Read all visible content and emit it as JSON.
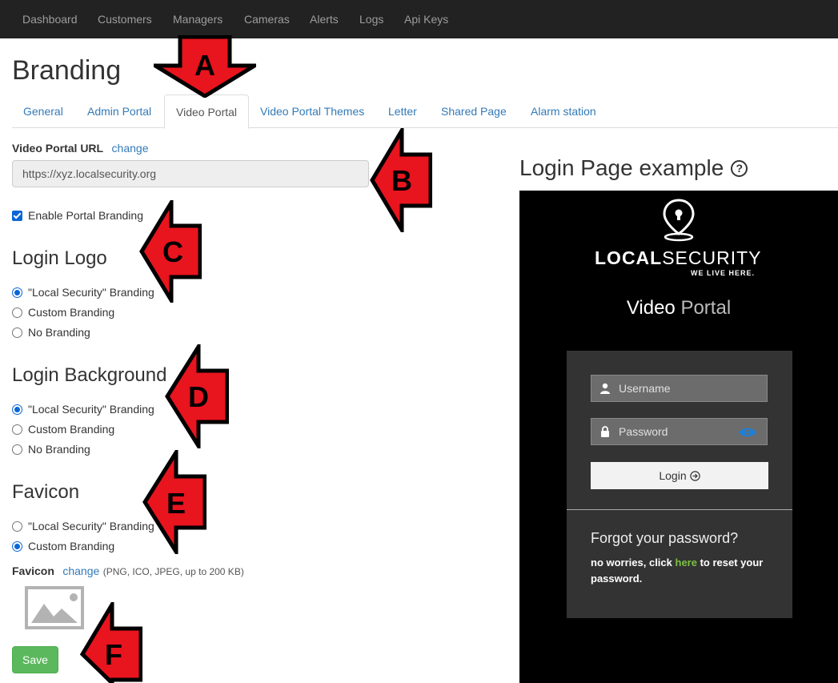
{
  "nav": {
    "items": [
      "Dashboard",
      "Customers",
      "Managers",
      "Cameras",
      "Alerts",
      "Logs",
      "Api Keys"
    ]
  },
  "page": {
    "title": "Branding"
  },
  "tabs": [
    "General",
    "Admin Portal",
    "Video Portal",
    "Video Portal Themes",
    "Letter",
    "Shared Page",
    "Alarm station"
  ],
  "active_tab": "Video Portal",
  "form": {
    "url_label": "Video Portal URL",
    "url_change": "change",
    "url_value": "https://xyz.localsecurity.org",
    "enable_label": "Enable Portal Branding",
    "enable_checked": true,
    "login_logo": {
      "title": "Login Logo",
      "options": [
        "\"Local Security\" Branding",
        "Custom Branding",
        "No Branding"
      ],
      "selected": 0
    },
    "login_background": {
      "title": "Login Background",
      "options": [
        "\"Local Security\" Branding",
        "Custom Branding",
        "No Branding"
      ],
      "selected": 0
    },
    "favicon": {
      "title": "Favicon",
      "options": [
        "\"Local Security\" Branding",
        "Custom Branding"
      ],
      "selected": 1,
      "label": "Favicon",
      "change": "change",
      "hint": "(PNG, ICO, JPEG, up to 200 KB)"
    },
    "save_label": "Save"
  },
  "preview": {
    "title": "Login Page example",
    "help_icon": "question-circle-icon",
    "brand_bold": "LOCAL",
    "brand_light": "SECURITY",
    "brand_tagline": "WE LIVE HERE.",
    "portal_title_a": "Video",
    "portal_title_b": "Portal",
    "username_placeholder": "Username",
    "password_placeholder": "Password",
    "login_label": "Login",
    "forgot_title": "Forgot your password?",
    "forgot_text_a": "no worries, click",
    "forgot_link": "here",
    "forgot_text_b": "to reset your password."
  },
  "annotations": [
    "A",
    "B",
    "C",
    "D",
    "E",
    "F"
  ],
  "colors": {
    "navbar": "#222222",
    "link": "#337ab7",
    "save": "#5cb85c",
    "annotation_fill": "#e8141e",
    "accent_green": "#7cc142"
  }
}
